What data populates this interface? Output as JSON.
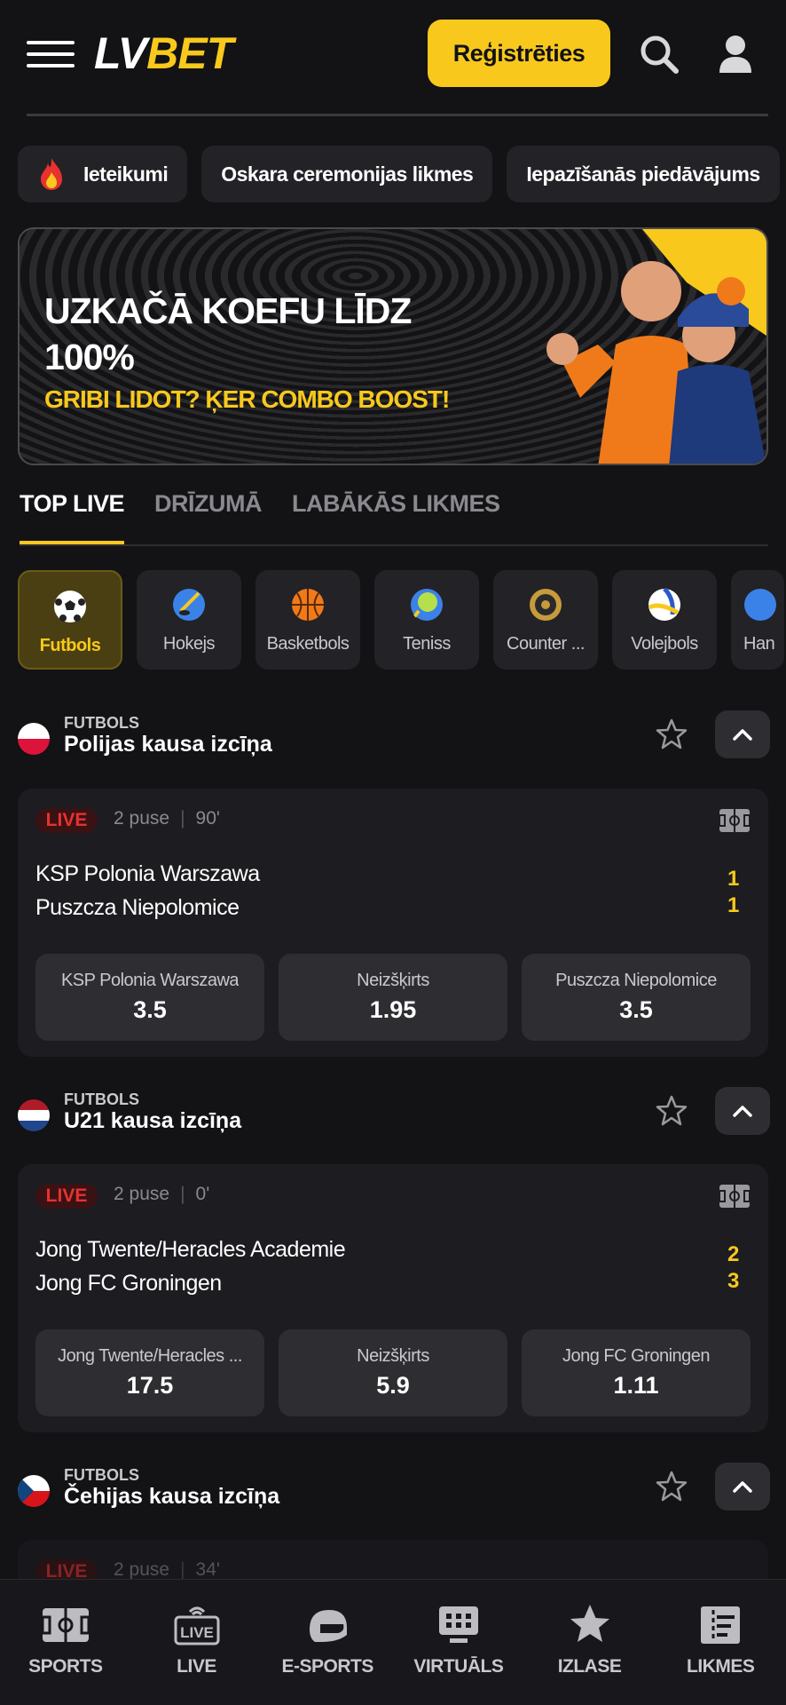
{
  "header": {
    "logo_lv": "LV",
    "logo_bet": "BET",
    "register_label": "Reģistrēties"
  },
  "promo_chips": [
    "Ieteikumi",
    "Oskara ceremonijas likmes",
    "Iepazīšanās piedāvājums"
  ],
  "banner": {
    "title": "UZKAČĀ KOEFU LĪDZ 100%",
    "subtitle": "GRIBI LIDOT? ĶER COMBO BOOST!"
  },
  "main_tabs": [
    "TOP LIVE",
    "DRĪZUMĀ",
    "LABĀKĀS LIKMES"
  ],
  "sports": [
    {
      "label": "Futbols",
      "icon": "football-icon"
    },
    {
      "label": "Hokejs",
      "icon": "hockey-icon"
    },
    {
      "label": "Basketbols",
      "icon": "basketball-icon"
    },
    {
      "label": "Teniss",
      "icon": "tennis-icon"
    },
    {
      "label": "Counter ...",
      "icon": "counter-strike-icon"
    },
    {
      "label": "Volejbols",
      "icon": "volleyball-icon"
    },
    {
      "label": "Han",
      "icon": "handball-icon"
    }
  ],
  "leagues": [
    {
      "category": "FUTBOLS",
      "name": "Polijas kausa izcīņa",
      "match": {
        "live": "LIVE",
        "period": "2 puse",
        "minute": "90'",
        "home": "KSP Polonia Warszawa",
        "away": "Puszcza Niepolomice",
        "home_score": "1",
        "away_score": "1",
        "odds": [
          {
            "label": "KSP Polonia Warszawa",
            "value": "3.5"
          },
          {
            "label": "Neizšķirts",
            "value": "1.95"
          },
          {
            "label": "Puszcza Niepolomice",
            "value": "3.5"
          }
        ]
      }
    },
    {
      "category": "FUTBOLS",
      "name": "U21 kausa izcīņa",
      "match": {
        "live": "LIVE",
        "period": "2 puse",
        "minute": "0'",
        "home": "Jong Twente/Heracles Academie",
        "away": "Jong FC Groningen",
        "home_score": "2",
        "away_score": "3",
        "odds": [
          {
            "label": "Jong Twente/Heracles ...",
            "value": "17.5"
          },
          {
            "label": "Neizšķirts",
            "value": "5.9"
          },
          {
            "label": "Jong FC Groningen",
            "value": "1.11"
          }
        ]
      }
    },
    {
      "category": "FUTBOLS",
      "name": "Čehijas kausa izcīņa",
      "match": {
        "live": "LIVE",
        "period": "2 puse",
        "minute": "34'"
      }
    }
  ],
  "bottom_nav": [
    "SPORTS",
    "LIVE",
    "E-SPORTS",
    "VIRTUĀLS",
    "IZLASE",
    "LIKMES"
  ],
  "colors": {
    "accent": "#f8c91c",
    "live": "#e8322f",
    "background": "#131215",
    "card": "#1d1c20"
  }
}
